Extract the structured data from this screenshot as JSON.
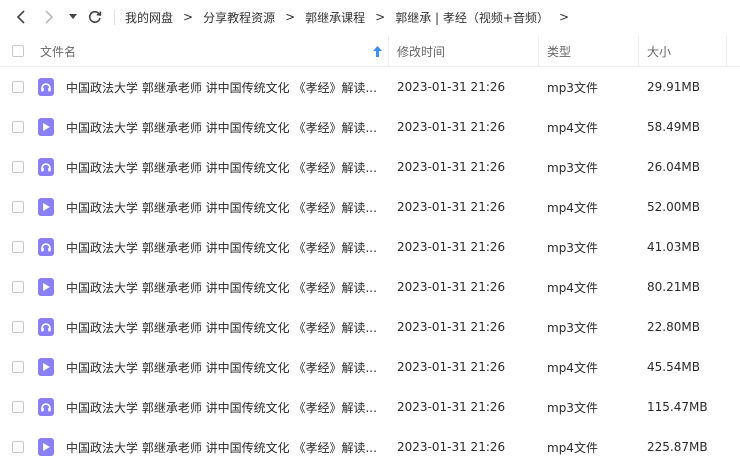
{
  "breadcrumb": [
    "我的网盘",
    "分享教程资源",
    "郭继承课程",
    "郭继承 | 孝经（视频+音频）"
  ],
  "columns": {
    "name": "文件名",
    "modified": "修改时间",
    "type": "类型",
    "size": "大小"
  },
  "files": [
    {
      "name": "中国政法大学 郭继承老师 讲中国传统文化 《孝经》解读...",
      "modified": "2023-01-31 21:26",
      "type": "mp3文件",
      "size": "29.91MB",
      "icon": "audio-file-icon"
    },
    {
      "name": "中国政法大学 郭继承老师 讲中国传统文化 《孝经》解读...",
      "modified": "2023-01-31 21:26",
      "type": "mp4文件",
      "size": "58.49MB",
      "icon": "video-file-icon"
    },
    {
      "name": "中国政法大学 郭继承老师 讲中国传统文化 《孝经》解读...",
      "modified": "2023-01-31 21:26",
      "type": "mp3文件",
      "size": "26.04MB",
      "icon": "audio-file-icon"
    },
    {
      "name": "中国政法大学 郭继承老师 讲中国传统文化 《孝经》解读...",
      "modified": "2023-01-31 21:26",
      "type": "mp4文件",
      "size": "52.00MB",
      "icon": "video-file-icon"
    },
    {
      "name": "中国政法大学 郭继承老师 讲中国传统文化 《孝经》解读...",
      "modified": "2023-01-31 21:26",
      "type": "mp3文件",
      "size": "41.03MB",
      "icon": "audio-file-icon"
    },
    {
      "name": "中国政法大学 郭继承老师 讲中国传统文化 《孝经》解读...",
      "modified": "2023-01-31 21:26",
      "type": "mp4文件",
      "size": "80.21MB",
      "icon": "video-file-icon"
    },
    {
      "name": "中国政法大学 郭继承老师 讲中国传统文化 《孝经》解读...",
      "modified": "2023-01-31 21:26",
      "type": "mp3文件",
      "size": "22.80MB",
      "icon": "audio-file-icon"
    },
    {
      "name": "中国政法大学 郭继承老师 讲中国传统文化 《孝经》解读...",
      "modified": "2023-01-31 21:26",
      "type": "mp4文件",
      "size": "45.54MB",
      "icon": "video-file-icon"
    },
    {
      "name": "中国政法大学 郭继承老师 讲中国传统文化 《孝经》解读...",
      "modified": "2023-01-31 21:26",
      "type": "mp3文件",
      "size": "115.47MB",
      "icon": "audio-file-icon"
    },
    {
      "name": "中国政法大学 郭继承老师 讲中国传统文化 《孝经》解读...",
      "modified": "2023-01-31 21:26",
      "type": "mp4文件",
      "size": "225.87MB",
      "icon": "video-file-icon"
    }
  ],
  "colors": {
    "file_icon_bg": "#8b7ff4",
    "sort_arrow": "#3e8ef7"
  }
}
